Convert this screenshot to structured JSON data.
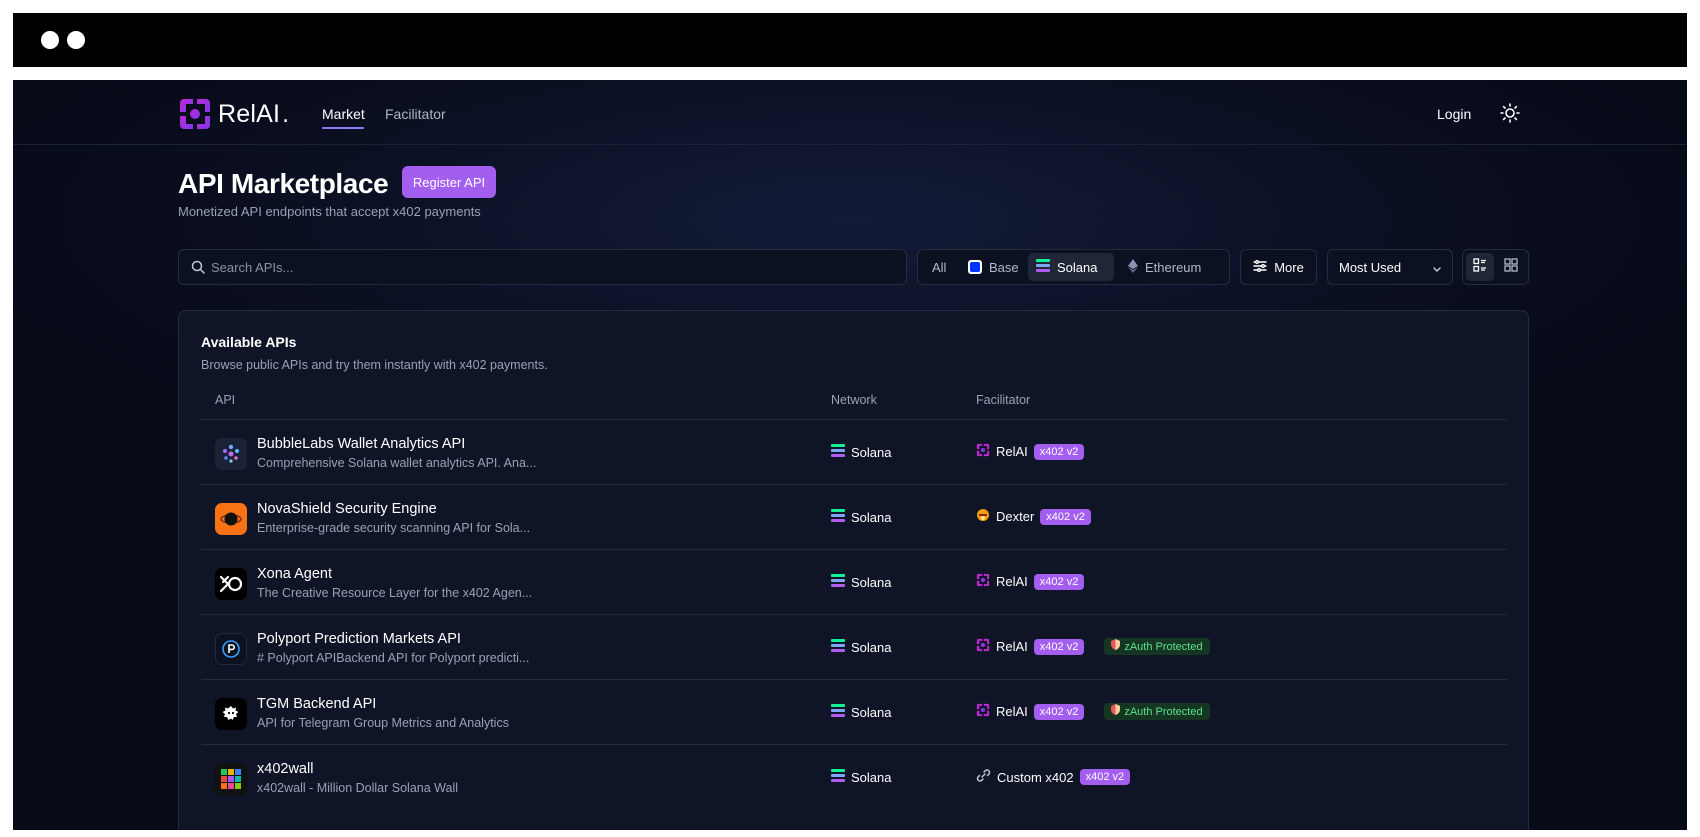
{
  "brand": {
    "name": "RelAI",
    "dot": "."
  },
  "nav": {
    "market": "Market",
    "facilitator": "Facilitator",
    "login": "Login"
  },
  "header": {
    "title": "API Marketplace",
    "register": "Register API",
    "subtitle": "Monetized API endpoints that accept x402 payments"
  },
  "filters": {
    "search_placeholder": "Search APIs...",
    "chains": [
      "All",
      "Base",
      "Solana",
      "Ethereum"
    ],
    "selected_chain": "Solana",
    "more": "More",
    "sort": "Most Used"
  },
  "panel": {
    "title": "Available APIs",
    "description": "Browse public APIs and try them instantly with x402 payments.",
    "columns": [
      "API",
      "Network",
      "Facilitator"
    ]
  },
  "rows": [
    {
      "name": "BubbleLabs Wallet Analytics API",
      "desc": "Comprehensive Solana wallet analytics API. Ana...",
      "network": "Solana",
      "facilitator": "RelAI",
      "badge": "x402 v2",
      "zauth": ""
    },
    {
      "name": "NovaShield Security Engine",
      "desc": "Enterprise-grade security scanning API for Sola...",
      "network": "Solana",
      "facilitator": "Dexter",
      "badge": "x402 v2",
      "zauth": ""
    },
    {
      "name": "Xona Agent",
      "desc": "The Creative Resource Layer for the x402 Agen...",
      "network": "Solana",
      "facilitator": "RelAI",
      "badge": "x402 v2",
      "zauth": ""
    },
    {
      "name": "Polyport Prediction Markets API",
      "desc": "# Polyport APIBackend API for Polyport predicti...",
      "network": "Solana",
      "facilitator": "RelAI",
      "badge": "x402 v2",
      "zauth": "zAuth Protected"
    },
    {
      "name": "TGM Backend API",
      "desc": "API for Telegram Group Metrics and Analytics",
      "network": "Solana",
      "facilitator": "RelAI",
      "badge": "x402 v2",
      "zauth": "zAuth Protected"
    },
    {
      "name": "x402wall",
      "desc": "x402wall - Million Dollar Solana Wall",
      "network": "Solana",
      "facilitator": "Custom x402",
      "badge": "x402 v2",
      "zauth": ""
    }
  ],
  "icons": {
    "search": "search-icon",
    "theme": "sun-icon",
    "more": "sliders-icon",
    "sort": "chevron-down-icon",
    "list_view": "list-view-icon",
    "grid_view": "grid-view-icon"
  },
  "colors": {
    "accent": "#a35ef0",
    "nav_underline": "#8b7cf6",
    "zauth_text": "#5fe08c",
    "background": "#0b1024"
  }
}
